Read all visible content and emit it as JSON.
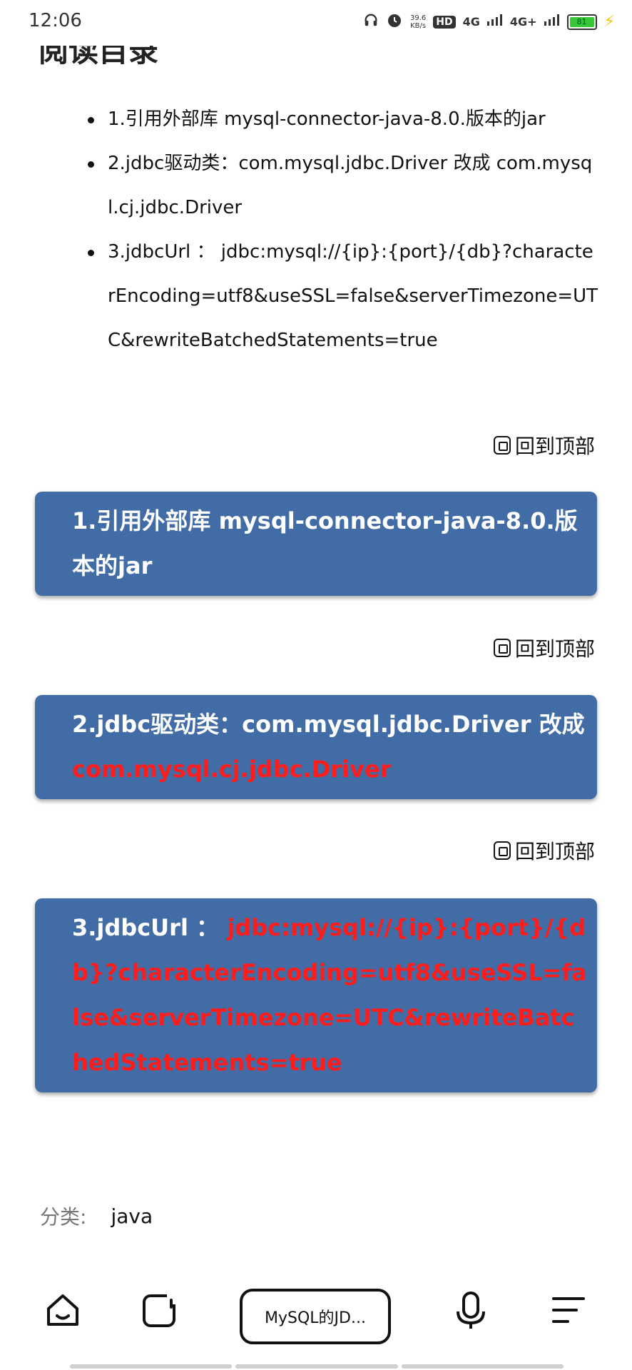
{
  "status": {
    "time": "12:06",
    "speed_value": "39.6",
    "speed_unit": "KB/s",
    "hd": "HD",
    "net1": "4G",
    "net2": "4G+",
    "battery": "81"
  },
  "toc": {
    "items": [
      "1.引用外部库 mysql-connector-java-8.0.版本的jar",
      "2.jdbc驱动类：com.mysql.jdbc.Driver 改成 com.mysql.cj.jdbc.Driver",
      "3.jdbcUrl ： jdbc:mysql://{ip}:{port}/{db}?characterEncoding=utf8&useSSL=false&serverTimezone=UTC&rewriteBatchedStatements=true"
    ]
  },
  "back_to_top": "回到顶部",
  "sections": [
    {
      "text": "1.引用外部库 mysql-connector-java-8.0.版本的jar",
      "highlight": ""
    },
    {
      "text": "2.jdbc驱动类：com.mysql.jdbc.Driver 改成 ",
      "highlight": "com.mysql.cj.jdbc.Driver"
    },
    {
      "text": "3.jdbcUrl ： ",
      "highlight": "jdbc:mysql://{ip}:{port}/{db}?characterEncoding=utf8&useSSL=false&serverTimezone=UTC&rewriteBatchedStatements=true"
    }
  ],
  "category": {
    "label": "分类:",
    "value": "java"
  },
  "bottom_nav": {
    "tab_title": "MySQL的JD..."
  },
  "colors": {
    "section_bg": "#416ca6",
    "highlight_red": "#ff1c1c"
  }
}
